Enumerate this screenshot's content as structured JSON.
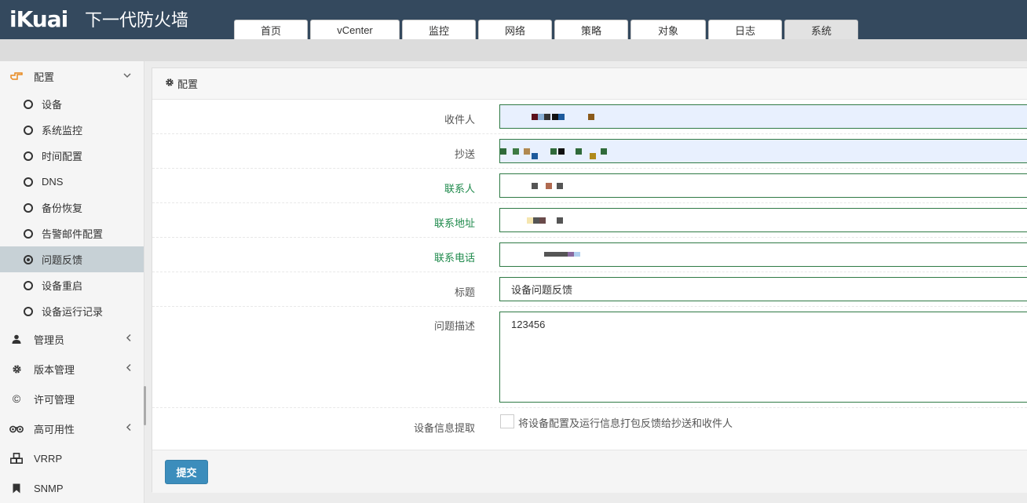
{
  "brand": {
    "logo": "iKuai",
    "title": "下一代防火墙"
  },
  "nav": {
    "tabs": [
      {
        "label": "首页",
        "name": "tab-home"
      },
      {
        "label": "vCenter",
        "name": "tab-vcenter"
      },
      {
        "label": "监控",
        "name": "tab-monitor"
      },
      {
        "label": "网络",
        "name": "tab-network"
      },
      {
        "label": "策略",
        "name": "tab-policy"
      },
      {
        "label": "对象",
        "name": "tab-object"
      },
      {
        "label": "日志",
        "name": "tab-log"
      },
      {
        "label": "系统",
        "name": "tab-system",
        "active": true
      }
    ]
  },
  "sidebar": {
    "config_label": "配置",
    "sub_items": [
      {
        "label": "设备"
      },
      {
        "label": "系统监控"
      },
      {
        "label": "时间配置"
      },
      {
        "label": "DNS"
      },
      {
        "label": "备份恢复"
      },
      {
        "label": "告警邮件配置"
      },
      {
        "label": "问题反馈",
        "active": true
      },
      {
        "label": "设备重启"
      },
      {
        "label": "设备运行记录"
      }
    ],
    "groups": [
      {
        "label": "管理员",
        "icon": "user-icon"
      },
      {
        "label": "版本管理",
        "icon": "gear-icon"
      },
      {
        "label": "许可管理",
        "icon": "copyright-icon"
      },
      {
        "label": "高可用性",
        "icon": "binoculars-icon"
      },
      {
        "label": "VRRP",
        "icon": "cubes-icon"
      },
      {
        "label": "SNMP",
        "icon": "bookmark-icon"
      }
    ]
  },
  "panel": {
    "title": "配置",
    "fields": {
      "recipient": {
        "label": "收件人"
      },
      "cc": {
        "label": "抄送"
      },
      "contact": {
        "label": "联系人"
      },
      "address": {
        "label": "联系地址"
      },
      "phone": {
        "label": "联系电话"
      },
      "subject": {
        "label": "标题",
        "value": "设备问题反馈"
      },
      "description": {
        "label": "问题描述",
        "value": "123456"
      },
      "device_info": {
        "label": "设备信息提取",
        "checkbox_label": "将设备配置及运行信息打包反馈给抄送和收件人",
        "checked": false
      }
    },
    "submit_label": "提交"
  },
  "colors": {
    "header_bg": "#34495e",
    "accent": "#3c8dbc",
    "required_label": "#1f8a4c",
    "field_border": "#2f7a45"
  }
}
